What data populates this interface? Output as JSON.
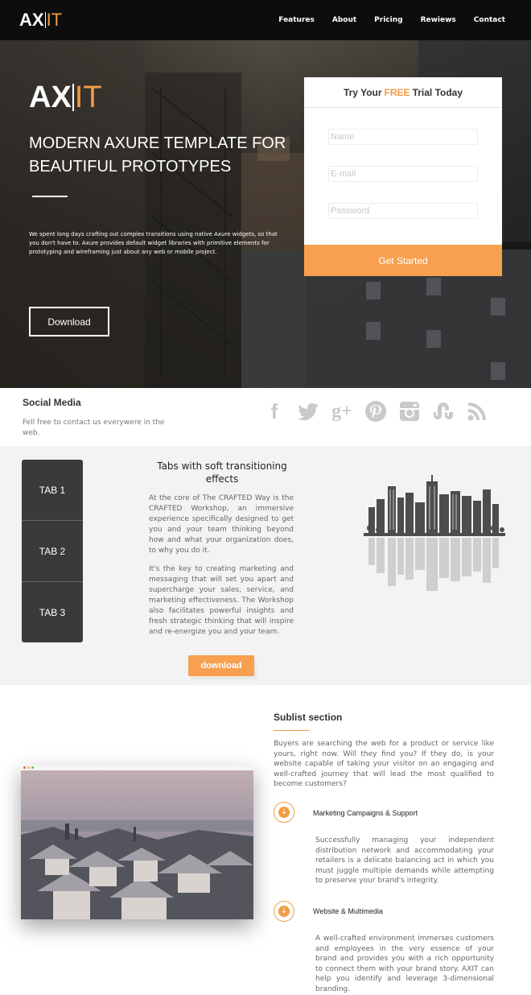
{
  "nav": {
    "logo_main": "AX",
    "logo_accent": "IT",
    "items": [
      {
        "label": "Features"
      },
      {
        "label": "About"
      },
      {
        "label": "Pricing"
      },
      {
        "label": "Rewiews"
      },
      {
        "label": "Contact"
      }
    ]
  },
  "hero": {
    "logo_main": "AX",
    "logo_accent": "IT",
    "headline": "MODERN AXURE TEMPLATE FOR BEAUTIFUL PROTOTYPES",
    "description": "We spent long days crafting out complex transitions using native Axure widgets, so that you don't have to. Axure provides default widget libraries with primitive elements for prototyping and wireframing just about any web or mobile project.",
    "download_label": "Download"
  },
  "trial_form": {
    "title_before": "Try Your",
    "title_free": "FREE",
    "title_after": "Trial Today",
    "name_placeholder": "Name",
    "email_placeholder": "E-mail",
    "password_placeholder": "Password",
    "submit_label": "Get Started",
    "accent_color": "#f7a04f"
  },
  "social": {
    "title": "Social Media",
    "text": "Fell free to contact us everywere in the web.",
    "icons": [
      "facebook-icon",
      "twitter-icon",
      "google-plus-icon",
      "pinterest-icon",
      "instagram-icon",
      "stumbleupon-icon",
      "rss-icon"
    ]
  },
  "tabs": {
    "items": [
      {
        "label": "TAB 1"
      },
      {
        "label": "TAB 2"
      },
      {
        "label": "TAB 3"
      }
    ],
    "title": "Tabs with soft transitioning effects",
    "paragraph1": "At the core of The CRAFTED Way is the CRAFTED Workshop, an immersive experience specifically designed to get you and your team thinking beyond how and what your organization does, to why you do it.",
    "paragraph2": "It's the key to creating marketing and messaging that will set you apart and supercharge your sales, service, and marketing effectiveness. The Workshop also facilitates powerful insights and fresh strategic thinking that will inspire and re-energize you and your team.",
    "download_label": "download"
  },
  "sublist": {
    "title": "Sublist section",
    "intro": "Buyers are searching the web for a product or service like yours, right now. Will they find you? If they do, is your website capable of taking your visitor on an engaging and well-crafted journey that will lead the most qualified to become customers?",
    "items": [
      {
        "title": "Marketing Campaigns & Support",
        "text": "Successfully managing your independent distribution network and accommodating your retailers is a delicate balancing act in which you must juggle multiple demands while attempting to preserve your brand's integrity."
      },
      {
        "title": "Website & Multimedia",
        "text": "A well-crafted environment immerses customers and employees in the very essence of your brand and provides you with a rich opportunity to connect them with your brand story. AXIT can help you identify and leverage 3-dimensional branding."
      }
    ]
  }
}
